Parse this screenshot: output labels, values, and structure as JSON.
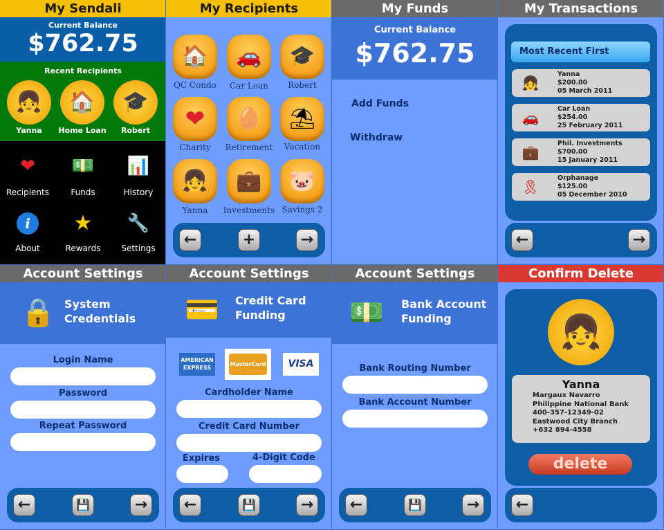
{
  "p1": {
    "title": "My Sendali",
    "balance_label": "Current Balance",
    "balance": "$762.75",
    "recent_label": "Recent Recipients",
    "recents": [
      {
        "label": "Yanna",
        "icon": "girl-avatar-icon"
      },
      {
        "label": "Home Loan",
        "icon": "house-icon"
      },
      {
        "label": "Robert",
        "icon": "graduation-cap-icon"
      }
    ],
    "menu": [
      {
        "label": "Recipients",
        "icon": "heart-icon"
      },
      {
        "label": "Funds",
        "icon": "money-icon"
      },
      {
        "label": "History",
        "icon": "bar-chart-icon"
      },
      {
        "label": "About",
        "icon": "info-icon"
      },
      {
        "label": "Rewards",
        "icon": "star-icon"
      },
      {
        "label": "Settings",
        "icon": "wrench-icon"
      }
    ]
  },
  "p2": {
    "title": "My Recipients",
    "items": [
      {
        "label": "QC Condo",
        "icon": "house-icon"
      },
      {
        "label": "Car Loan",
        "icon": "car-icon"
      },
      {
        "label": "Robert",
        "icon": "graduation-cap-icon"
      },
      {
        "label": "Charity",
        "icon": "heart-icon"
      },
      {
        "label": "Retirement",
        "icon": "nest-egg-icon"
      },
      {
        "label": "Vacation",
        "icon": "beach-umbrella-icon"
      },
      {
        "label": "Yanna",
        "icon": "girl-avatar-icon"
      },
      {
        "label": "Investments",
        "icon": "briefcase-icon"
      },
      {
        "label": "Savings 2",
        "icon": "piggy-bank-icon"
      }
    ]
  },
  "p3": {
    "title": "My Funds",
    "balance_label": "Current Balance",
    "balance": "$762.75",
    "actions": [
      "Add Funds",
      "Withdraw"
    ]
  },
  "p4": {
    "title": "My Transactions",
    "sort_label": "Most Recent First",
    "transactions": [
      {
        "name": "Yanna",
        "amount": "$200.00",
        "date": "05 March 2011",
        "icon": "girl-avatar-icon"
      },
      {
        "name": "Car Loan",
        "amount": "$254.00",
        "date": "25 February 2011",
        "icon": "car-icon"
      },
      {
        "name": "Phil. Investments",
        "amount": "$700.00",
        "date": "15 January 2011",
        "icon": "briefcase-icon"
      },
      {
        "name": "Orphanage",
        "amount": "$125.00",
        "date": "05 December 2010",
        "icon": "ribbon-icon"
      }
    ]
  },
  "p5": {
    "title": "Account Settings",
    "section": "System Credentials",
    "fields": [
      "Login Name",
      "Password",
      "Repeat Password"
    ]
  },
  "p6": {
    "title": "Account Settings",
    "section": "Credit Card Funding",
    "cards": [
      "AMERICAN EXPRESS",
      "MasterCard",
      "VISA"
    ],
    "fields": [
      "Cardholder Name",
      "Credit Card Number"
    ],
    "expires_label": "Expires",
    "code_label": "4-Digit Code"
  },
  "p7": {
    "title": "Account Settings",
    "section": "Bank Account Funding",
    "fields": [
      "Bank Routing Number",
      "Bank Account Number"
    ]
  },
  "p8": {
    "title": "Confirm Delete",
    "name": "Yanna",
    "details": [
      "Margaux Navarro",
      "Philippine National Bank",
      "400-357-12349-02",
      "Eastwood City Branch",
      "+632 894-4558"
    ],
    "delete_label": "delete"
  },
  "colors": {
    "panel_bg": "#6e9dff",
    "nav_blue": "#0d5ea6",
    "header_yellow": "#f5bf0a",
    "header_gray": "#6a6a6a",
    "header_red": "#d83a32",
    "home_green": "#00780a",
    "home_balance_blue": "#0a5ea8"
  }
}
